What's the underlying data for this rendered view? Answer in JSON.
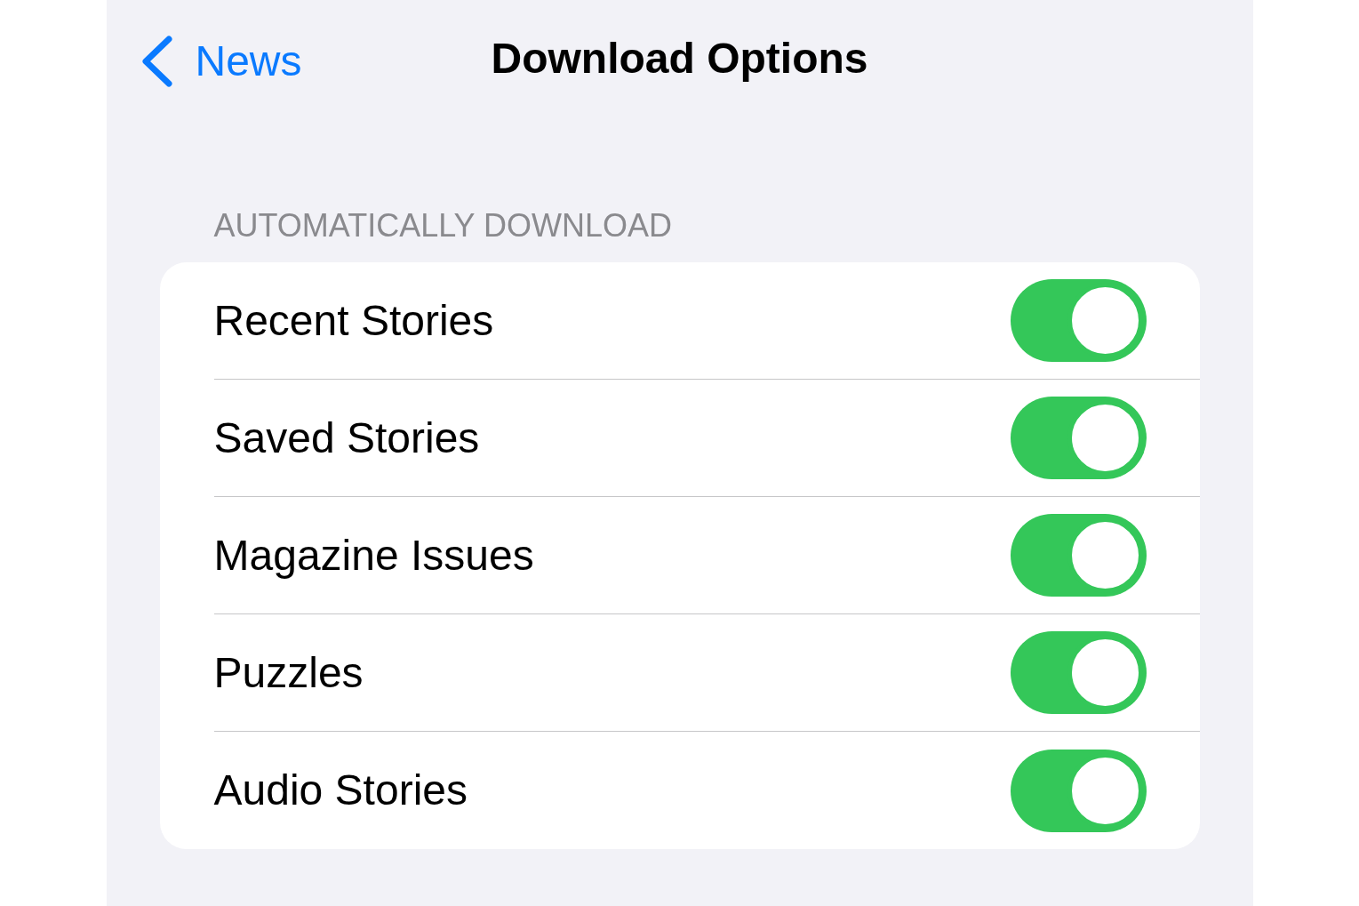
{
  "nav": {
    "back_label": "News",
    "title": "Download Options"
  },
  "section": {
    "header": "AUTOMATICALLY DOWNLOAD",
    "rows": [
      {
        "label": "Recent Stories",
        "on": true
      },
      {
        "label": "Saved Stories",
        "on": true
      },
      {
        "label": "Magazine Issues",
        "on": true
      },
      {
        "label": "Puzzles",
        "on": true
      },
      {
        "label": "Audio Stories",
        "on": true
      }
    ]
  }
}
